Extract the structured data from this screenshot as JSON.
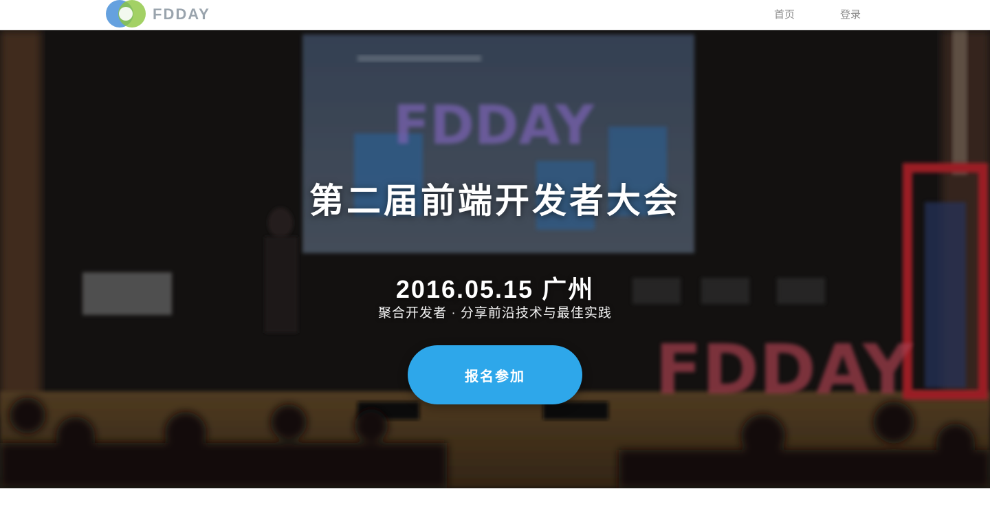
{
  "header": {
    "logo_text": "FDDAY",
    "logo_icon": "fdday-logo-icon",
    "nav": [
      {
        "label": "首页"
      },
      {
        "label": "登录"
      }
    ]
  },
  "hero": {
    "screen_logo": "FDDAY",
    "stage_logo": "FDDAY",
    "title": "第二届前端开发者大会",
    "date": "2016.05.15 广州",
    "subtitle": "聚合开发者 · 分享前沿技术与最佳实践",
    "cta_label": "报名参加"
  },
  "colors": {
    "accent": "#2ea7ea",
    "nav_text": "#8c8c8c",
    "hero_bg": "#181615"
  }
}
